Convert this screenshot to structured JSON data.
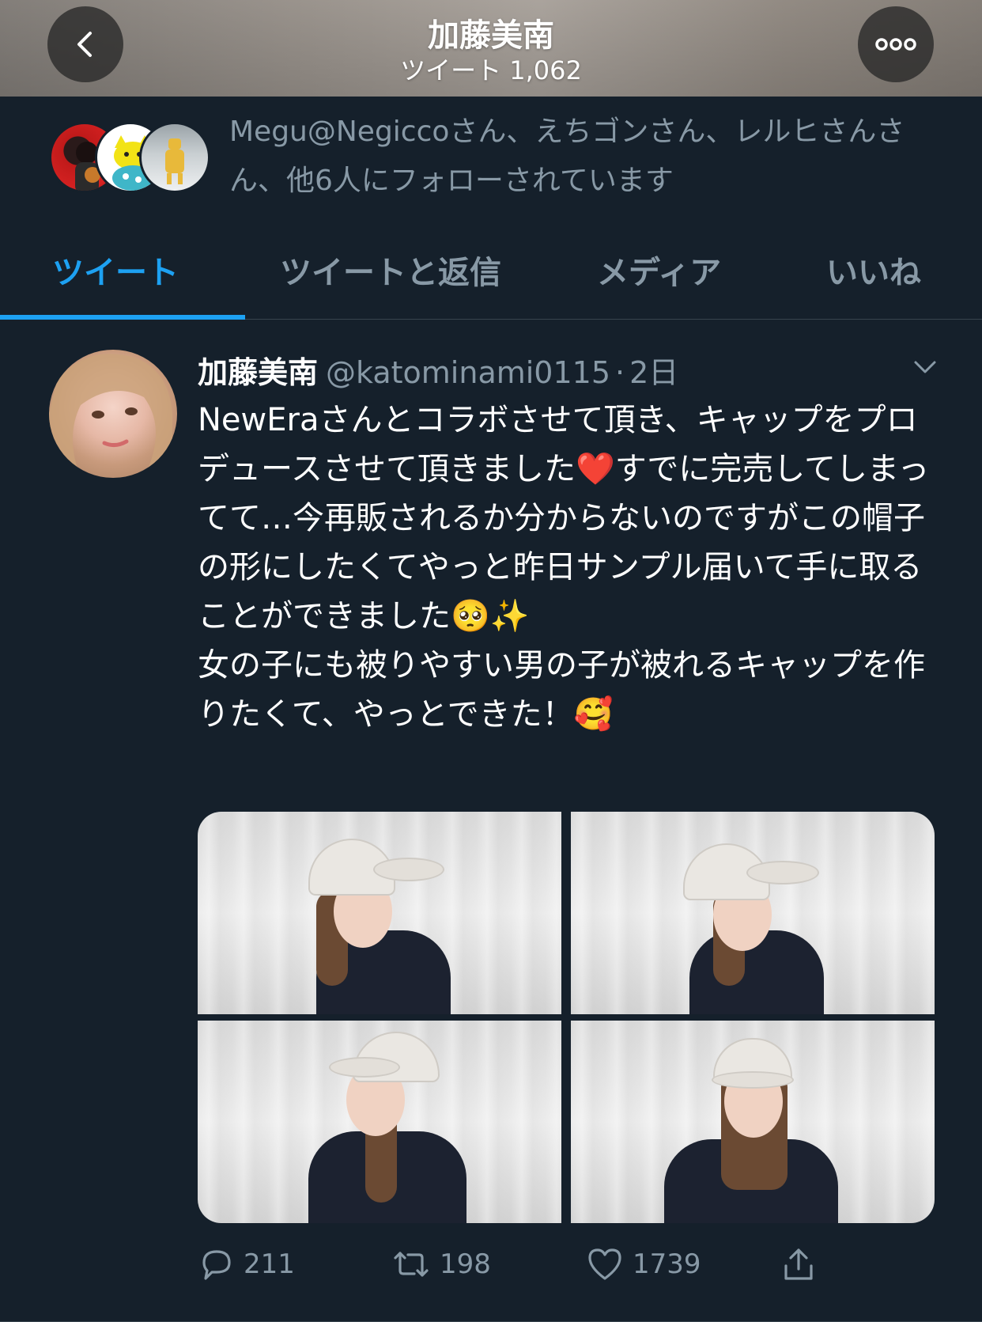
{
  "header": {
    "title": "加藤美南",
    "subtitle": "ツイート 1,062",
    "back_icon": "chevron-left-icon",
    "more_icon": "more-horizontal-icon"
  },
  "followed_by": {
    "text": "Megu@Negiccoさん、えちゴンさん、レルヒさんさん、他6人にフォローされています"
  },
  "tabs": [
    {
      "label": "ツイート",
      "active": true
    },
    {
      "label": "ツイートと返信",
      "active": false
    },
    {
      "label": "メディア",
      "active": false
    },
    {
      "label": "いいね",
      "active": false
    }
  ],
  "tweet": {
    "name": "加藤美南",
    "handle": "@katominami0115",
    "separator": "·",
    "time": "2日",
    "text": "NewEraさんとコラボさせて頂き、キャップをプロデュースさせて頂きました❤️すでに完売してしまってて…今再販されるか分からないのですがこの帽子の形にしたくてやっと昨日サンプル届いて手に取ることができました🥺✨\n女の子にも被りやすい男の子が被れるキャップを作りたくて、やっとできた！🥰",
    "counts": {
      "replies": "211",
      "retweets": "198",
      "likes": "1739"
    }
  },
  "colors": {
    "background": "#15202b",
    "accent": "#1da1f2",
    "muted": "#8899a6",
    "border": "#38444d"
  }
}
